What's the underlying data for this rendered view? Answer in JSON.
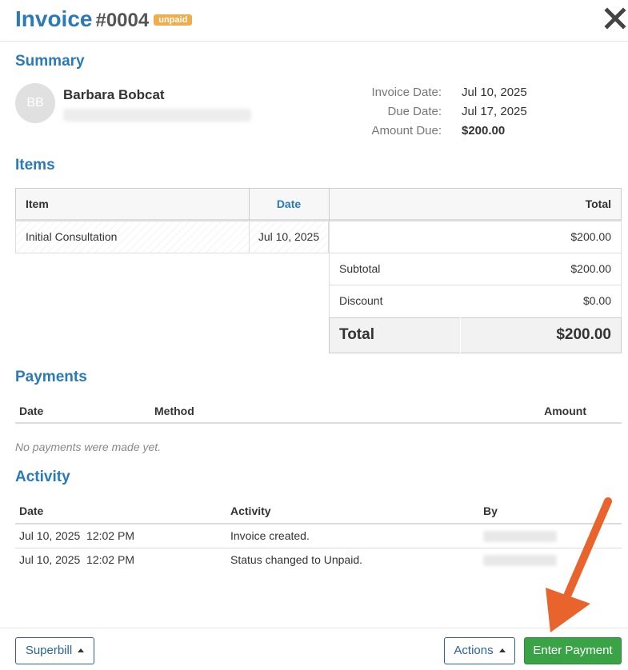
{
  "header": {
    "title": "Invoice",
    "number": "#0004",
    "status_badge": "unpaid"
  },
  "summary": {
    "heading": "Summary",
    "avatar_initials": "BB",
    "patient_name": "Barbara Bobcat",
    "invoice_date_label": "Invoice Date:",
    "invoice_date": "Jul 10, 2025",
    "due_date_label": "Due Date:",
    "due_date": "Jul 17, 2025",
    "amount_due_label": "Amount Due:",
    "amount_due": "$200.00"
  },
  "items": {
    "heading": "Items",
    "columns": {
      "item": "Item",
      "date": "Date",
      "total": "Total"
    },
    "rows": [
      {
        "item": "Initial Consultation",
        "date": "Jul 10, 2025",
        "total": "$200.00"
      }
    ],
    "subtotal_label": "Subtotal",
    "subtotal": "$200.00",
    "discount_label": "Discount",
    "discount": "$0.00",
    "total_label": "Total",
    "total": "$200.00"
  },
  "payments": {
    "heading": "Payments",
    "columns": {
      "date": "Date",
      "method": "Method",
      "amount": "Amount"
    },
    "empty_message": "No payments were made yet."
  },
  "activity": {
    "heading": "Activity",
    "columns": {
      "date": "Date",
      "activity": "Activity",
      "by": "By"
    },
    "rows": [
      {
        "date": "Jul 10, 2025  12:02 PM",
        "activity": "Invoice created."
      },
      {
        "date": "Jul 10, 2025  12:02 PM",
        "activity": "Status changed to Unpaid."
      }
    ]
  },
  "footer": {
    "superbill_label": "Superbill",
    "actions_label": "Actions",
    "enter_payment_label": "Enter Payment"
  },
  "colors": {
    "heading_blue": "#2a7ab8",
    "badge_orange": "#f0ad4e",
    "primary_green": "#3aa346",
    "arrow_orange": "#e8642c"
  },
  "icons": {
    "close": "close-icon",
    "caret": "caret-up-icon",
    "annotation": "arrow-annotation"
  }
}
